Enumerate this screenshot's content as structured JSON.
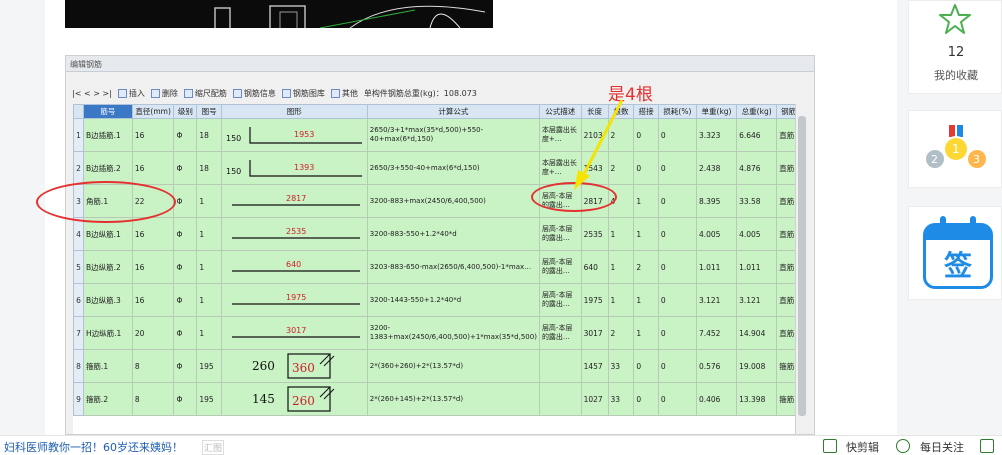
{
  "window_title": "编辑钢筋",
  "toolbar": {
    "nav": "|< < > >|",
    "insert": "插入",
    "delete": "删除",
    "ruler": "缩尺配筋",
    "rebar_info": "钢筋信息",
    "rebar_lib": "钢筋图库",
    "other": "其他",
    "total_weight": "单构件钢筋总重(kg)：108.073"
  },
  "columns": [
    "筋号",
    "直径(mm)",
    "级别",
    "图号",
    "图形",
    "计算公式",
    "公式描述",
    "长度",
    "根数",
    "搭接",
    "损耗(%)",
    "单重(kg)",
    "总重(kg)",
    "钢筋"
  ],
  "rows": [
    {
      "n": "1",
      "name": "B边插筋.1",
      "dia": "16",
      "grade": "Φ",
      "fig": "18",
      "shape_left": "150",
      "shape_val": "1953",
      "formula": "2650/3+1*max(35*d,500)+550-40+max(6*d,150)",
      "desc": "本层露出长度+…",
      "len": "2103",
      "count": "2",
      "lap": "0",
      "loss": "0",
      "unit": "3.323",
      "total": "6.646",
      "type": "直筋"
    },
    {
      "n": "2",
      "name": "B边插筋.2",
      "dia": "16",
      "grade": "Φ",
      "fig": "18",
      "shape_left": "150",
      "shape_val": "1393",
      "formula": "2650/3+550-40+max(6*d,150)",
      "desc": "本层露出长度+…",
      "len": "1543",
      "count": "2",
      "lap": "0",
      "loss": "0",
      "unit": "2.438",
      "total": "4.876",
      "type": "直筋"
    },
    {
      "n": "3",
      "name": "角筋.1",
      "dia": "22",
      "grade": "Φ",
      "fig": "1",
      "shape_left": "",
      "shape_val": "2817",
      "formula": "3200-883+max(2450/6,400,500)",
      "desc": "层高-本层的露出…",
      "len": "2817",
      "count": "4",
      "lap": "1",
      "loss": "0",
      "unit": "8.395",
      "total": "33.58",
      "type": "直筋"
    },
    {
      "n": "4",
      "name": "B边纵筋.1",
      "dia": "16",
      "grade": "Φ",
      "fig": "1",
      "shape_left": "",
      "shape_val": "2535",
      "formula": "3200-883-550+1.2*40*d",
      "desc": "层高-本层的露出…",
      "len": "2535",
      "count": "1",
      "lap": "1",
      "loss": "0",
      "unit": "4.005",
      "total": "4.005",
      "type": "直筋"
    },
    {
      "n": "5",
      "name": "B边纵筋.2",
      "dia": "16",
      "grade": "Φ",
      "fig": "1",
      "shape_left": "",
      "shape_val": "640",
      "formula": "3203-883-650-max(2650/6,400,500)-1*max…",
      "desc": "层高-本层的露出…",
      "len": "640",
      "count": "1",
      "lap": "2",
      "loss": "0",
      "unit": "1.011",
      "total": "1.011",
      "type": "直筋"
    },
    {
      "n": "6",
      "name": "B边纵筋.3",
      "dia": "16",
      "grade": "Φ",
      "fig": "1",
      "shape_left": "",
      "shape_val": "1975",
      "formula": "3200-1443-550+1.2*40*d",
      "desc": "层高-本层的露出…",
      "len": "1975",
      "count": "1",
      "lap": "1",
      "loss": "0",
      "unit": "3.121",
      "total": "3.121",
      "type": "直筋"
    },
    {
      "n": "7",
      "name": "H边纵筋.1",
      "dia": "20",
      "grade": "Φ",
      "fig": "1",
      "shape_left": "",
      "shape_val": "3017",
      "formula": "3200-1383+max(2450/6,400,500)+1*max(35*d,500)",
      "desc": "层高-本层的露出…",
      "len": "3017",
      "count": "2",
      "lap": "1",
      "loss": "0",
      "unit": "7.452",
      "total": "14.904",
      "type": "直筋"
    },
    {
      "n": "8",
      "name": "箍筋.1",
      "dia": "8",
      "grade": "Φ",
      "fig": "195",
      "shape_left": "260",
      "shape_val": "360",
      "formula": "2*(360+260)+2*(13.57*d)",
      "desc": "",
      "len": "1457",
      "count": "33",
      "lap": "0",
      "loss": "0",
      "unit": "0.576",
      "total": "19.008",
      "type": "箍筋"
    },
    {
      "n": "9",
      "name": "箍筋.2",
      "dia": "8",
      "grade": "Φ",
      "fig": "195",
      "shape_left": "145",
      "shape_val": "260",
      "formula": "2*(260+145)+2*(13.57*d)",
      "desc": "",
      "len": "1027",
      "count": "33",
      "lap": "0",
      "loss": "0",
      "unit": "0.406",
      "total": "13.398",
      "type": "箍筋"
    }
  ],
  "annotation": "是4根",
  "sidebar": {
    "collect_count": "12",
    "collect_label": "我的收藏",
    "sign_label": "签"
  },
  "bottom": {
    "news": "妇科医师教你一招！60岁还来姨妈！",
    "ad_tag": "汇图",
    "quick_edit": "快剪辑",
    "daily": "每日关注"
  },
  "colors": {
    "grid_green": "#c9f2c5",
    "header_blue": "#d8e6f4",
    "annotation_red": "#e53030",
    "annotation_yellow": "#f5e400",
    "sidebar_blue": "#1e8ce6"
  }
}
